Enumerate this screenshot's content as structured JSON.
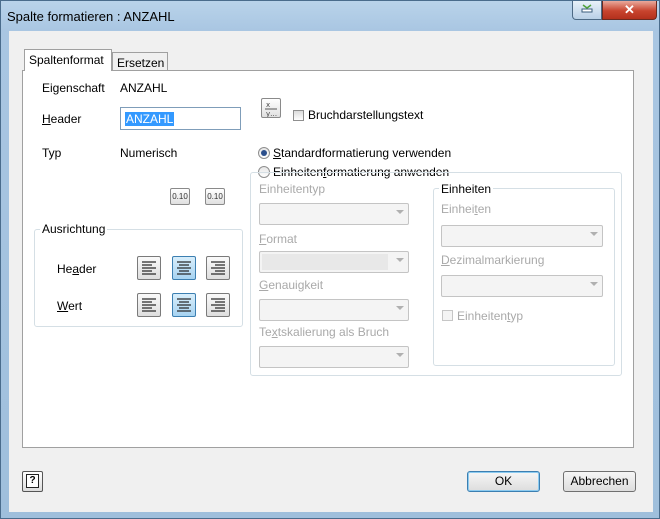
{
  "window": {
    "title": "Spalte formatieren : ANZAHL",
    "close_glyph": "✕"
  },
  "tabs": [
    {
      "label": "Spaltenformat"
    },
    {
      "label": "Ersetzen"
    }
  ],
  "properties": {
    "eigenschaft_label": "Eigenschaft",
    "eigenschaft_value": "ANZAHL",
    "header_label": "Header",
    "header_value": "ANZAHL",
    "typ_label": "Typ",
    "typ_value": "Numerisch",
    "precision_btn_label": "0.10"
  },
  "fraction": {
    "checkbox_label": "Bruchdarstellungstext",
    "checked": false
  },
  "formatting_mode": {
    "standard_label": "Standardformatierung verwenden",
    "units_label": "Einheitenformatierung anwenden",
    "selected": "standard"
  },
  "units_left": {
    "einheitentyp_label": "Einheitentyp",
    "format_label": "Format",
    "genauigkeit_label": "Genauigkeit",
    "textskalierung_label": "Textskalierung als Bruch"
  },
  "einheiten_group": {
    "legend": "Einheiten",
    "einheiten_label": "Einheiten",
    "dezimal_label": "Dezimalmarkierung",
    "einheitentyp_checkbox_label": "Einheitentyp"
  },
  "ausrichtung": {
    "legend": "Ausrichtung",
    "header_label": "Header",
    "wert_label": "Wert",
    "header_selected": "center",
    "wert_selected": "center"
  },
  "footer": {
    "help_glyph": "?",
    "ok_label": "OK",
    "cancel_label": "Abbrechen"
  },
  "colors": {
    "selection": "#3399ff",
    "title_bar": "#b9d3ea",
    "close_button": "#c8442e"
  }
}
